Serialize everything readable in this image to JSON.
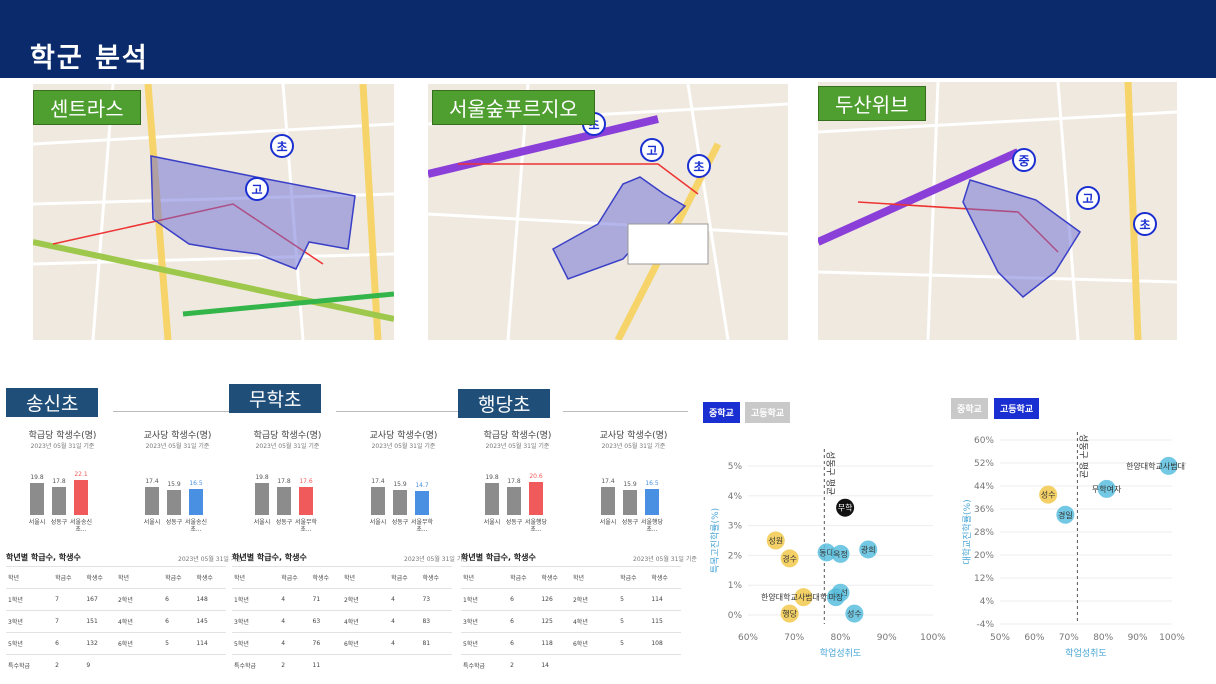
{
  "header": {
    "title": "학군 분석"
  },
  "colors": {
    "header_bg": "#0b2a6b",
    "tag_green": "#4f9e30",
    "tag_navy": "#1f4e79",
    "tab_active": "#1a2fd1",
    "tab_inactive": "#c9c9c9",
    "bar_gray": "#8c8c8c",
    "bar_red": "#f05a5a",
    "bar_blue": "#4a90e2"
  },
  "maps": [
    {
      "label": "센트라스"
    },
    {
      "label": "서울숲푸르지오"
    },
    {
      "label": "두산위브"
    }
  ],
  "schools": [
    {
      "name": "송신초",
      "charts": [
        {
          "title": "학급당 학생수(명)",
          "sub": "2023년 05월 31일 기준",
          "bars": [
            {
              "label": "서울시",
              "value": "19.8",
              "color": "gray"
            },
            {
              "label": "성동구",
              "value": "17.8",
              "color": "gray"
            },
            {
              "label": "서울송신초...",
              "value": "22.1",
              "color": "red"
            }
          ]
        },
        {
          "title": "교사당 학생수(명)",
          "sub": "2023년 05월 31일 기준",
          "bars": [
            {
              "label": "서울시",
              "value": "17.4",
              "color": "gray"
            },
            {
              "label": "성동구",
              "value": "15.9",
              "color": "gray"
            },
            {
              "label": "서울송신초...",
              "value": "16.5",
              "color": "blue"
            }
          ]
        }
      ],
      "table": {
        "title": "학년별 학급수, 학생수",
        "date": "2023년 05월 31일 기준",
        "headers": [
          "학년",
          "학급수",
          "학생수",
          "학년",
          "학급수",
          "학생수"
        ],
        "rows": [
          [
            "1학년",
            "7",
            "167",
            "2학년",
            "6",
            "148"
          ],
          [
            "3학년",
            "7",
            "151",
            "4학년",
            "6",
            "145"
          ],
          [
            "5학년",
            "6",
            "132",
            "6학년",
            "5",
            "114"
          ],
          [
            "특수학급",
            "2",
            "9",
            "",
            "",
            ""
          ]
        ]
      }
    },
    {
      "name": "무학초",
      "charts": [
        {
          "title": "학급당 학생수(명)",
          "sub": "2023년 05월 31일 기준",
          "bars": [
            {
              "label": "서울시",
              "value": "19.8",
              "color": "gray"
            },
            {
              "label": "성동구",
              "value": "17.8",
              "color": "gray"
            },
            {
              "label": "서울무학초...",
              "value": "17.6",
              "color": "red"
            }
          ]
        },
        {
          "title": "교사당 학생수(명)",
          "sub": "2023년 05월 31일 기준",
          "bars": [
            {
              "label": "서울시",
              "value": "17.4",
              "color": "gray"
            },
            {
              "label": "성동구",
              "value": "15.9",
              "color": "gray"
            },
            {
              "label": "서울무학초...",
              "value": "14.7",
              "color": "blue"
            }
          ]
        }
      ],
      "table": {
        "title": "학년별 학급수, 학생수",
        "date": "2023년 05월 31일 기준",
        "headers": [
          "학년",
          "학급수",
          "학생수",
          "학년",
          "학급수",
          "학생수"
        ],
        "rows": [
          [
            "1학년",
            "4",
            "71",
            "2학년",
            "4",
            "73"
          ],
          [
            "3학년",
            "4",
            "63",
            "4학년",
            "4",
            "83"
          ],
          [
            "5학년",
            "4",
            "76",
            "6학년",
            "4",
            "81"
          ],
          [
            "특수학급",
            "2",
            "11",
            "",
            "",
            ""
          ]
        ]
      }
    },
    {
      "name": "행당초",
      "charts": [
        {
          "title": "학급당 학생수(명)",
          "sub": "2023년 05월 31일 기준",
          "bars": [
            {
              "label": "서울시",
              "value": "19.8",
              "color": "gray"
            },
            {
              "label": "성동구",
              "value": "17.8",
              "color": "gray"
            },
            {
              "label": "서울행당초...",
              "value": "20.6",
              "color": "red"
            }
          ]
        },
        {
          "title": "교사당 학생수(명)",
          "sub": "2023년 05월 31일 기준",
          "bars": [
            {
              "label": "서울시",
              "value": "17.4",
              "color": "gray"
            },
            {
              "label": "성동구",
              "value": "15.9",
              "color": "gray"
            },
            {
              "label": "서울행당초...",
              "value": "16.5",
              "color": "blue"
            }
          ]
        }
      ],
      "table": {
        "title": "학년별 학급수, 학생수",
        "date": "2023년 05월 31일 기준",
        "headers": [
          "학년",
          "학급수",
          "학생수",
          "학년",
          "학급수",
          "학생수"
        ],
        "rows": [
          [
            "1학년",
            "6",
            "126",
            "2학년",
            "5",
            "114"
          ],
          [
            "3학년",
            "6",
            "125",
            "4학년",
            "5",
            "115"
          ],
          [
            "5학년",
            "6",
            "118",
            "6학년",
            "5",
            "108"
          ],
          [
            "특수학급",
            "2",
            "14",
            "",
            "",
            ""
          ]
        ]
      }
    }
  ],
  "scatter_panels": [
    {
      "tabs": [
        "중학교",
        "고등학교"
      ],
      "active": 0,
      "xlabel": "학업성취도",
      "ylabel": "특목고진학률(%)",
      "vline_label": "성동구 평균"
    },
    {
      "tabs": [
        "중학교",
        "고등학교"
      ],
      "active": 1,
      "xlabel": "학업성취도",
      "ylabel": "대학교진학률(%)",
      "vline_label": "성동구 평균"
    }
  ],
  "chart_data": [
    {
      "type": "scatter",
      "xlabel": "학업성취도",
      "ylabel": "특목고진학률(%)",
      "x_ticks": [
        "60%",
        "70%",
        "80%",
        "90%",
        "100%"
      ],
      "y_ticks": [
        "0%",
        "1%",
        "2%",
        "3%",
        "4%",
        "5%"
      ],
      "xlim": [
        60,
        100
      ],
      "ylim": [
        -0.3,
        5.3
      ],
      "reference_x": 76.5,
      "points": [
        {
          "label": "무학",
          "x": 81,
          "y": 3.6,
          "color": "#111111"
        },
        {
          "label": "광희",
          "x": 86,
          "y": 2.2,
          "color": "#5bc0de"
        },
        {
          "label": "동대",
          "x": 77,
          "y": 2.1,
          "color": "#5bc0de"
        },
        {
          "label": "옥정",
          "x": 80,
          "y": 2.05,
          "color": "#5bc0de"
        },
        {
          "label": "성원",
          "x": 66,
          "y": 2.5,
          "color": "#f2c94c"
        },
        {
          "label": "경수",
          "x": 69,
          "y": 1.9,
          "color": "#f2c94c"
        },
        {
          "label": "한양대학교사범대학부속",
          "x": 72,
          "y": 0.6,
          "color": "#f2c94c"
        },
        {
          "label": "도선",
          "x": 80,
          "y": 0.75,
          "color": "#5bc0de"
        },
        {
          "label": "마장",
          "x": 79,
          "y": 0.6,
          "color": "#5bc0de"
        },
        {
          "label": "행당",
          "x": 69,
          "y": 0.05,
          "color": "#f2c94c"
        },
        {
          "label": "성수",
          "x": 83,
          "y": 0.05,
          "color": "#5bc0de"
        }
      ]
    },
    {
      "type": "scatter",
      "xlabel": "학업성취도",
      "ylabel": "대학교진학률(%)",
      "x_ticks": [
        "50%",
        "60%",
        "70%",
        "80%",
        "90%",
        "100%"
      ],
      "y_ticks": [
        "-4%",
        "4%",
        "12%",
        "20%",
        "28%",
        "36%",
        "44%",
        "52%",
        "60%"
      ],
      "xlim": [
        50,
        100
      ],
      "ylim": [
        -4,
        60
      ],
      "reference_x": 72.5,
      "points": [
        {
          "label": "한양대학교사범대학부속",
          "x": 99,
          "y": 51,
          "color": "#5bc0de"
        },
        {
          "label": "무학여자",
          "x": 81,
          "y": 43,
          "color": "#5bc0de"
        },
        {
          "label": "성수",
          "x": 64,
          "y": 41,
          "color": "#f2c94c"
        },
        {
          "label": "경일",
          "x": 69,
          "y": 34,
          "color": "#5bc0de"
        }
      ]
    }
  ]
}
